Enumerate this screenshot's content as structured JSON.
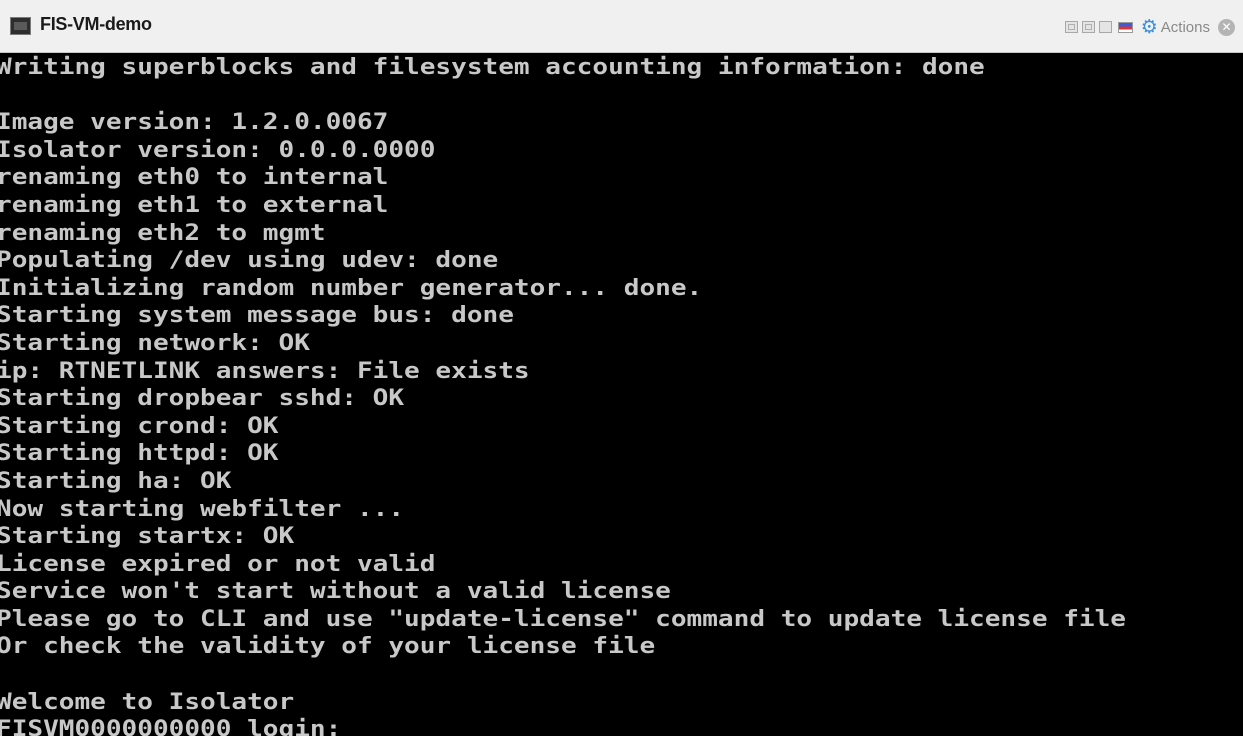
{
  "window": {
    "title": "FIS-VM-demo",
    "actions_label": "Actions",
    "close_glyph": "✕",
    "gear_glyph": "⚙",
    "icons": [
      "console-icon",
      "restore-icon",
      "minimize-icon",
      "maximize-icon",
      "keyboard-flag-icon",
      "gear-icon",
      "close-icon"
    ]
  },
  "console": {
    "text_color": "#c8c8c8",
    "background": "#000000",
    "lines": [
      "Writing superblocks and filesystem accounting information: done",
      "",
      "Image version: 1.2.0.0067",
      "Isolator version: 0.0.0.0000",
      "renaming eth0 to internal",
      "renaming eth1 to external",
      "renaming eth2 to mgmt",
      "Populating /dev using udev: done",
      "Initializing random number generator... done.",
      "Starting system message bus: done",
      "Starting network: OK",
      "ip: RTNETLINK answers: File exists",
      "Starting dropbear sshd: OK",
      "Starting crond: OK",
      "Starting httpd: OK",
      "Starting ha: OK",
      "Now starting webfilter ...",
      "Starting startx: OK",
      "License expired or not valid",
      "Service won't start without a valid license",
      "Please go to CLI and use \"update-license\" command to update license file",
      "Or check the validity of your license file",
      "",
      "Welcome to Isolator",
      "FISVM0000000000 login: "
    ]
  }
}
